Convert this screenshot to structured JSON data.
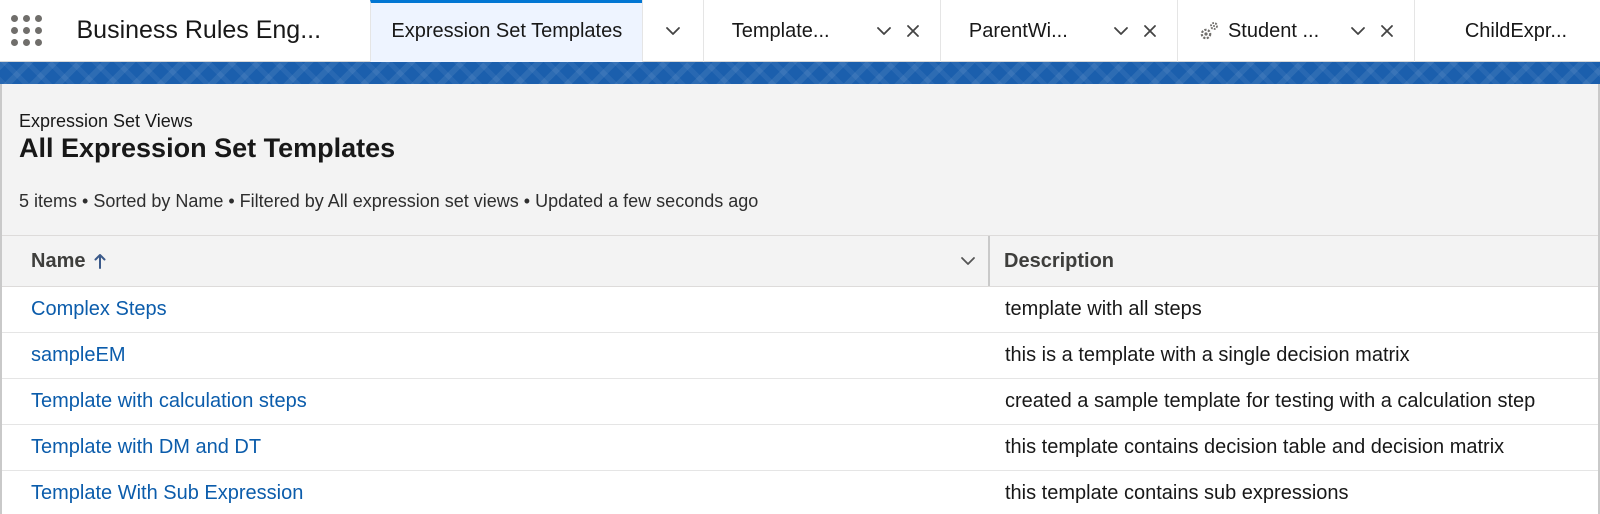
{
  "app": {
    "name": "Business Rules Eng..."
  },
  "tabs": [
    {
      "label": "Expression Set Templates",
      "active": true
    },
    {
      "label": "Template...",
      "active": false
    },
    {
      "label": "ParentWi...",
      "active": false
    },
    {
      "label": "Student ...",
      "active": false,
      "icon": "gear-icon"
    },
    {
      "label": "ChildExpr...",
      "active": false
    }
  ],
  "header": {
    "object_label": "Expression Set Views",
    "title": "All Expression Set Templates",
    "meta": "5 items • Sorted by Name • Filtered by All expression set views • Updated a few seconds ago"
  },
  "table": {
    "columns": [
      {
        "label": "Name",
        "sort": "ascending"
      },
      {
        "label": "Description"
      }
    ],
    "rows": [
      {
        "name": "Complex Steps",
        "description": "template with all steps"
      },
      {
        "name": "sampleEM",
        "description": "this is a template with a single decision matrix"
      },
      {
        "name": "Template with calculation steps",
        "description": "created a sample template for testing with a calculation step"
      },
      {
        "name": "Template with DM and DT",
        "description": "this template contains decision table and decision matrix"
      },
      {
        "name": "Template With Sub Expression",
        "description": "this template contains sub expressions"
      }
    ]
  },
  "colors": {
    "accent": "#0176d3",
    "link": "#0b5cab",
    "band": "#1b5fad",
    "active_tab_bg": "#eef4ff"
  }
}
